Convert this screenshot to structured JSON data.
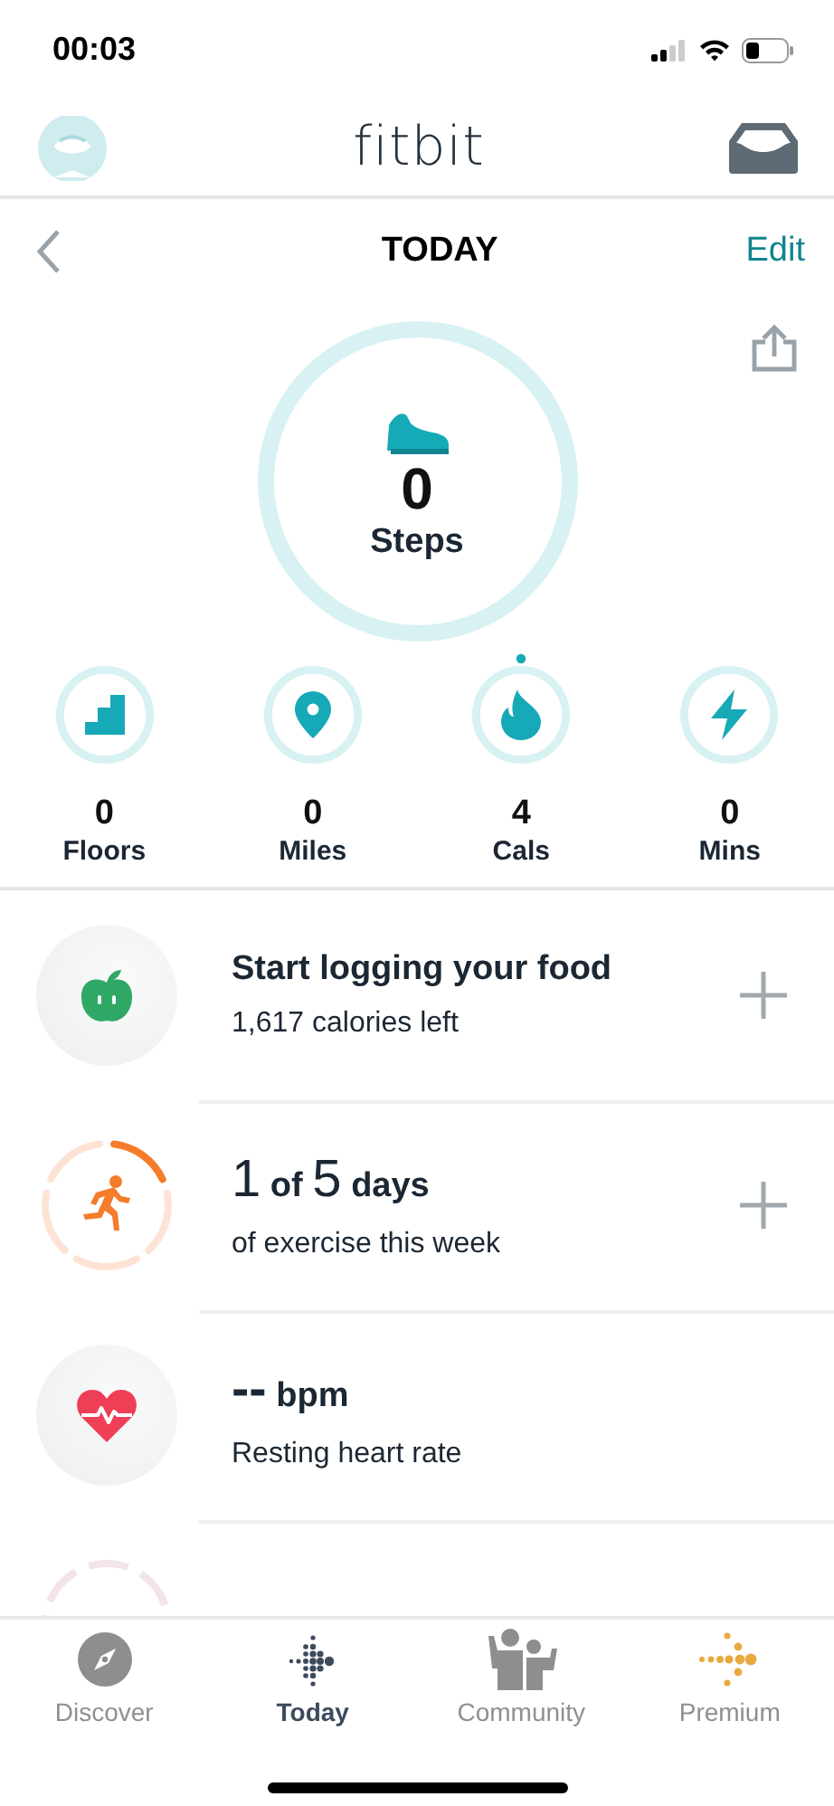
{
  "status_bar": {
    "time": "00:03"
  },
  "header": {
    "logo": "fitbit"
  },
  "date_bar": {
    "title": "TODAY",
    "edit": "Edit"
  },
  "steps": {
    "value": "0",
    "label": "Steps"
  },
  "stats": [
    {
      "kind": "floors",
      "value": "0",
      "label": "Floors",
      "progress_dot": false
    },
    {
      "kind": "distance",
      "value": "0",
      "label": "Miles",
      "progress_dot": false
    },
    {
      "kind": "calories",
      "value": "4",
      "label": "Cals",
      "progress_dot": true
    },
    {
      "kind": "minutes",
      "value": "0",
      "label": "Mins",
      "progress_dot": false
    }
  ],
  "tiles": [
    {
      "kind": "food",
      "title": [
        {
          "kind": "text",
          "text": "Start logging your food"
        }
      ],
      "subtitle": "1,617 calories left",
      "add": true
    },
    {
      "kind": "exercise",
      "title": [
        {
          "kind": "number",
          "text": "1"
        },
        {
          "kind": "text",
          "text": "of"
        },
        {
          "kind": "number",
          "text": "5"
        },
        {
          "kind": "text",
          "text": "days"
        }
      ],
      "subtitle": "of exercise this week",
      "add": true,
      "segments": [
        {
          "filled": true
        },
        {
          "filled": false
        },
        {
          "filled": false
        },
        {
          "filled": false
        },
        {
          "filled": false
        }
      ]
    },
    {
      "kind": "heart",
      "title": [
        {
          "kind": "number",
          "text": "--"
        },
        {
          "kind": "text",
          "text": "bpm"
        }
      ],
      "subtitle": "Resting heart rate",
      "add": false
    },
    {
      "kind": "partial"
    }
  ],
  "tab_bar": [
    {
      "kind": "discover",
      "label": "Discover",
      "selected": false
    },
    {
      "kind": "today",
      "label": "Today",
      "selected": true
    },
    {
      "kind": "community",
      "label": "Community",
      "selected": false
    },
    {
      "kind": "premium",
      "label": "Premium",
      "selected": false
    }
  ]
}
